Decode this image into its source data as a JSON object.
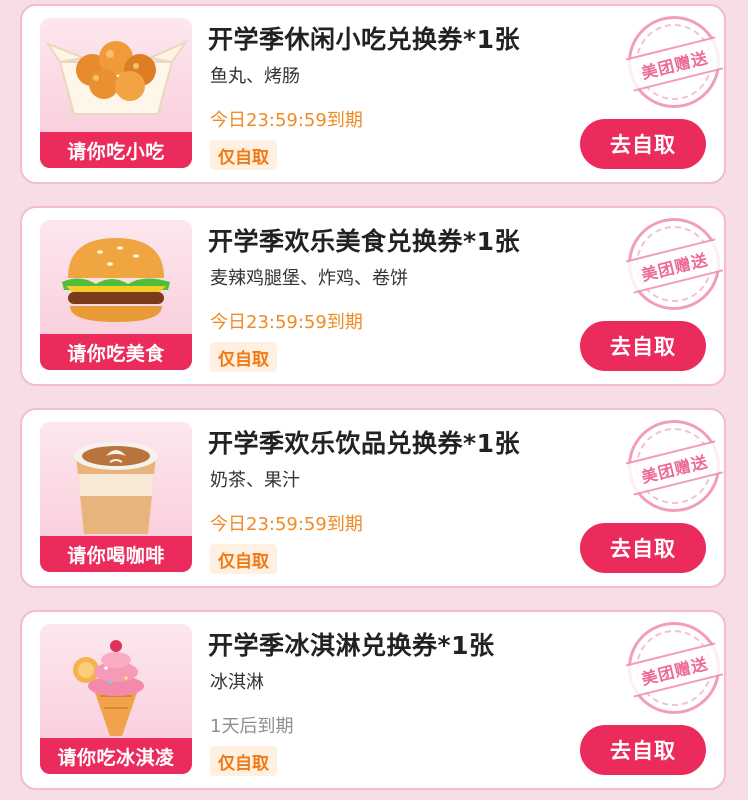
{
  "coupons": [
    {
      "thumb_label": "请你吃小吃",
      "title": "开学季休闲小吃兑换券*1张",
      "desc": "鱼丸、烤肠",
      "expiry": "今日23:59:59到期",
      "tag": "仅自取",
      "stamp": "美团赠送",
      "button": "去自取",
      "icon": "fried-chicken-icon"
    },
    {
      "thumb_label": "请你吃美食",
      "title": "开学季欢乐美食兑换券*1张",
      "desc": "麦辣鸡腿堡、炸鸡、卷饼",
      "expiry": "今日23:59:59到期",
      "tag": "仅自取",
      "stamp": "美团赠送",
      "button": "去自取",
      "icon": "burger-icon"
    },
    {
      "thumb_label": "请你喝咖啡",
      "title": "开学季欢乐饮品兑换券*1张",
      "desc": "奶茶、果汁",
      "expiry": "今日23:59:59到期",
      "tag": "仅自取",
      "stamp": "美团赠送",
      "button": "去自取",
      "icon": "coffee-cup-icon"
    },
    {
      "thumb_label": "请你吃冰淇凌",
      "title": "开学季冰淇淋兑换券*1张",
      "desc": "冰淇淋",
      "expiry": "1天后到期",
      "tag": "仅自取",
      "stamp": "美团赠送",
      "button": "去自取",
      "icon": "ice-cream-icon"
    }
  ],
  "colors": {
    "accent": "#ea2b5c",
    "expiry_today": "#f08a24",
    "expiry_later": "#8e8e8e",
    "tag_bg": "#fff0e2",
    "card_border": "#f4bccd"
  }
}
